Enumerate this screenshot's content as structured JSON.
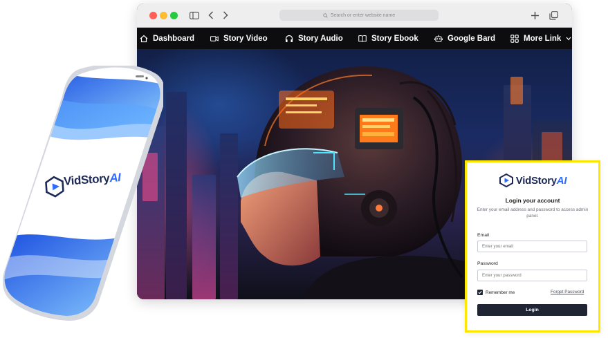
{
  "browser": {
    "url_placeholder": "Search or enter website name"
  },
  "navbar": {
    "items": [
      {
        "label": "Dashboard",
        "icon": "home-icon"
      },
      {
        "label": "Story Video",
        "icon": "video-camera-icon"
      },
      {
        "label": "Story Audio",
        "icon": "headphones-icon"
      },
      {
        "label": "Story Ebook",
        "icon": "book-open-icon"
      },
      {
        "label": "Google Bard",
        "icon": "robot-icon"
      },
      {
        "label": "More Link",
        "icon": "grid-icon"
      }
    ]
  },
  "phone": {
    "brand_name": "VidStory",
    "brand_suffix": "AI"
  },
  "login": {
    "brand_name": "VidStory",
    "brand_suffix": "AI",
    "title": "Login your account",
    "subtitle": "Enter your email address and password to access admin panel.",
    "email_label": "Email",
    "email_placeholder": "Enter your email",
    "password_label": "Password",
    "password_placeholder": "Enter your password",
    "remember_label": "Remember me",
    "remember_checked": true,
    "forgot_label": "Forget Password",
    "submit_label": "Login"
  },
  "colors": {
    "accent_yellow": "#ffe600",
    "brand_navy": "#1d2a55",
    "brand_blue": "#2f6bff",
    "button_dark": "#1f2532"
  }
}
